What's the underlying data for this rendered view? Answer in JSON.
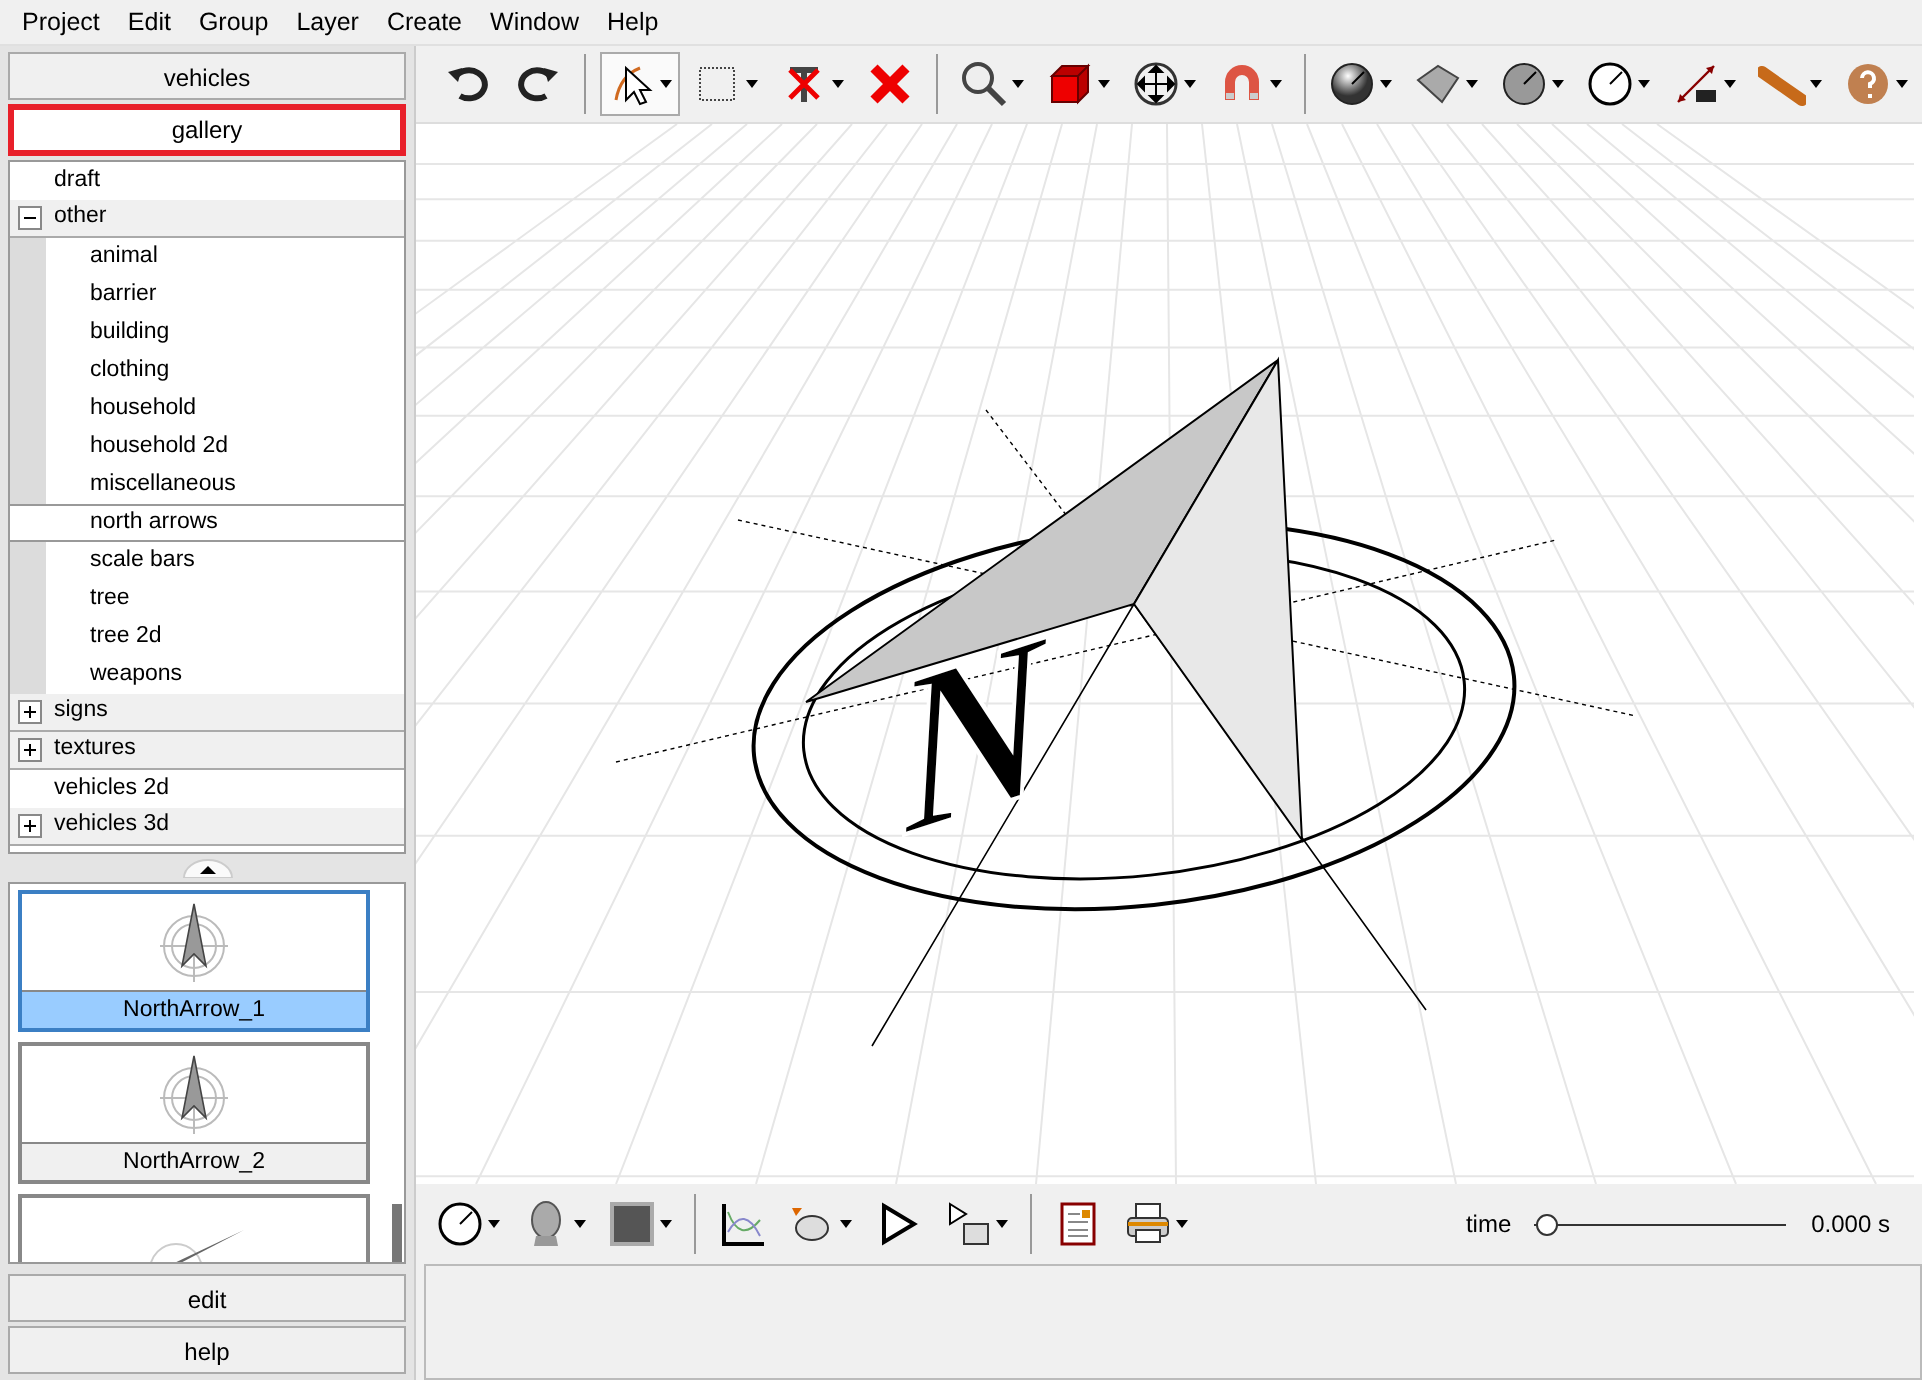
{
  "menu": [
    "Project",
    "Edit",
    "Group",
    "Layer",
    "Create",
    "Window",
    "Help"
  ],
  "panel_tabs_top": [
    {
      "label": "vehicles",
      "selected": false
    },
    {
      "label": "gallery",
      "selected": true
    }
  ],
  "tree": [
    {
      "label": "draft",
      "kind": "leaf",
      "selected": false
    },
    {
      "label": "other",
      "kind": "group",
      "expanded": true,
      "selected": false,
      "children": [
        {
          "label": "animal",
          "selected": false
        },
        {
          "label": "barrier",
          "selected": false
        },
        {
          "label": "building",
          "selected": false
        },
        {
          "label": "clothing",
          "selected": false
        },
        {
          "label": "household",
          "selected": false
        },
        {
          "label": "household 2d",
          "selected": false
        },
        {
          "label": "miscellaneous",
          "selected": false
        },
        {
          "label": "north arrows",
          "selected": true
        },
        {
          "label": "scale bars",
          "selected": false
        },
        {
          "label": "tree",
          "selected": false
        },
        {
          "label": "tree 2d",
          "selected": false
        },
        {
          "label": "weapons",
          "selected": false
        }
      ]
    },
    {
      "label": "signs",
      "kind": "group",
      "expanded": false,
      "selected": false
    },
    {
      "label": "textures",
      "kind": "group",
      "expanded": false,
      "selected": false
    },
    {
      "label": "vehicles 2d",
      "kind": "leaf",
      "selected": false
    },
    {
      "label": "vehicles 3d",
      "kind": "group",
      "expanded": false,
      "selected": false
    }
  ],
  "thumbnails": [
    {
      "label": "NorthArrow_1",
      "selected": true,
      "kind": "compass"
    },
    {
      "label": "NorthArrow_2",
      "selected": false,
      "kind": "compass"
    },
    {
      "selected": false,
      "kind": "slanted"
    }
  ],
  "panel_tabs_bottom": [
    {
      "label": "edit"
    },
    {
      "label": "help"
    }
  ],
  "toolbar": [
    {
      "kind": "undo",
      "selected": false,
      "dropdown": false
    },
    {
      "kind": "redo",
      "selected": false,
      "dropdown": false
    },
    {
      "kind": "sep"
    },
    {
      "kind": "select",
      "selected": true,
      "dropdown": true
    },
    {
      "kind": "rect-select",
      "selected": false,
      "dropdown": true
    },
    {
      "kind": "pin",
      "selected": false,
      "dropdown": true
    },
    {
      "kind": "delete",
      "selected": false,
      "dropdown": false
    },
    {
      "kind": "sep"
    },
    {
      "kind": "zoom",
      "selected": false,
      "dropdown": true
    },
    {
      "kind": "cube",
      "selected": false,
      "dropdown": true
    },
    {
      "kind": "move",
      "selected": false,
      "dropdown": true
    },
    {
      "kind": "magnet",
      "selected": false,
      "dropdown": true
    },
    {
      "kind": "sep"
    },
    {
      "kind": "sphere",
      "selected": false,
      "dropdown": true
    },
    {
      "kind": "surface",
      "selected": false,
      "dropdown": true
    },
    {
      "kind": "disc",
      "selected": false,
      "dropdown": true
    },
    {
      "kind": "circle",
      "selected": false,
      "dropdown": true
    },
    {
      "kind": "measure",
      "selected": false,
      "dropdown": true
    },
    {
      "kind": "tube",
      "selected": false,
      "dropdown": true
    },
    {
      "kind": "help",
      "selected": false,
      "dropdown": true
    }
  ],
  "viewport": {
    "model_letter": "N"
  },
  "bottom_toolbar": [
    {
      "kind": "circle",
      "dropdown": true
    },
    {
      "kind": "head",
      "dropdown": true
    },
    {
      "kind": "square",
      "dropdown": true
    },
    {
      "kind": "sep"
    },
    {
      "kind": "graph",
      "dropdown": false
    },
    {
      "kind": "teapot",
      "dropdown": true
    },
    {
      "kind": "play",
      "dropdown": false
    },
    {
      "kind": "play-list",
      "dropdown": true
    },
    {
      "kind": "sep"
    },
    {
      "kind": "report",
      "dropdown": false
    },
    {
      "kind": "printer",
      "dropdown": true
    }
  ],
  "time": {
    "label": "time",
    "level": 0,
    "reading": "0.000 s"
  }
}
